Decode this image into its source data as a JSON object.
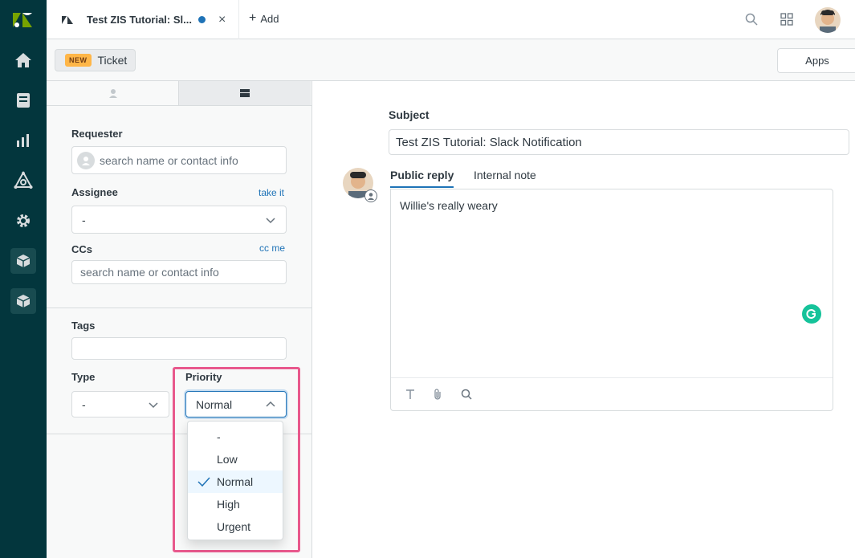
{
  "top_tab": {
    "title": "Test ZIS Tutorial: Sl...",
    "close": "×"
  },
  "add_button": {
    "label": "Add"
  },
  "subbar": {
    "badge": "NEW",
    "ticket_label": "Ticket",
    "apps_label": "Apps"
  },
  "fields": {
    "requester": {
      "label": "Requester",
      "placeholder": "search name or contact info"
    },
    "assignee": {
      "label": "Assignee",
      "link": "take it",
      "value": "-"
    },
    "ccs": {
      "label": "CCs",
      "link": "cc me",
      "placeholder": "search name or contact info"
    },
    "tags": {
      "label": "Tags"
    },
    "type": {
      "label": "Type",
      "value": "-"
    },
    "priority": {
      "label": "Priority",
      "value": "Normal"
    }
  },
  "priority_options": [
    {
      "label": "-",
      "selected": false
    },
    {
      "label": "Low",
      "selected": false
    },
    {
      "label": "Normal",
      "selected": true
    },
    {
      "label": "High",
      "selected": false
    },
    {
      "label": "Urgent",
      "selected": false
    }
  ],
  "main": {
    "subject_label": "Subject",
    "subject_value": "Test ZIS Tutorial: Slack Notification",
    "reply_tabs": [
      "Public reply",
      "Internal note"
    ],
    "editor_text": "Willie's really weary"
  },
  "colors": {
    "nav_bg": "#03363d",
    "accent": "#1f73b7",
    "highlight": "#e8588c",
    "logo": "#78a300"
  },
  "icons": [
    "zendesk-logo",
    "home-icon",
    "views-icon",
    "reporting-icon",
    "admin-icon",
    "settings-icon",
    "app-box-icon",
    "search-icon",
    "products-grid-icon",
    "user-icon",
    "ticket-icon",
    "chevron-down-icon",
    "chevron-up-icon",
    "check-icon",
    "text-format-icon",
    "attachment-icon",
    "knowledge-search-icon",
    "grammarly-icon"
  ]
}
